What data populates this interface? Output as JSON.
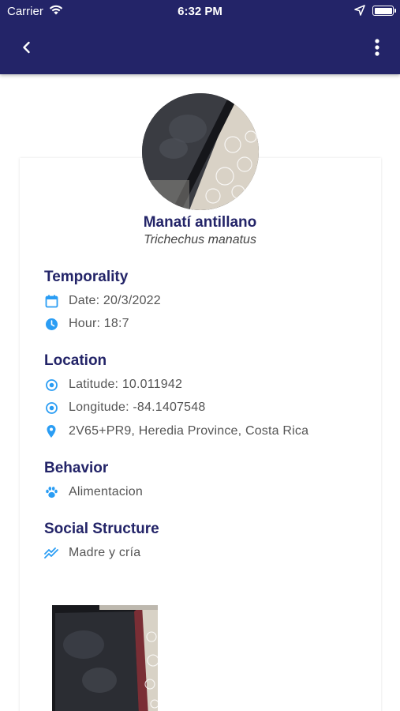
{
  "status_bar": {
    "carrier": "Carrier",
    "time": "6:32 PM"
  },
  "colors": {
    "header": "#232468",
    "accent": "#2a9df4",
    "title": "#232468"
  },
  "header": {
    "back_icon": "chevron-left-icon",
    "menu_icon": "more-vertical-icon"
  },
  "species": {
    "common_name": "Manatí antillano",
    "scientific_name": "Trichechus manatus"
  },
  "temporality": {
    "title": "Temporality",
    "date": "Date: 20/3/2022",
    "hour": "Hour: 18:7"
  },
  "location": {
    "title": "Location",
    "latitude": "Latitude: 10.011942",
    "longitude": "Longitude: -84.1407548",
    "address": "2V65+PR9, Heredia Province, Costa Rica"
  },
  "behavior": {
    "title": "Behavior",
    "value": "Alimentacion"
  },
  "social_structure": {
    "title": "Social Structure",
    "value": "Madre y cría"
  }
}
